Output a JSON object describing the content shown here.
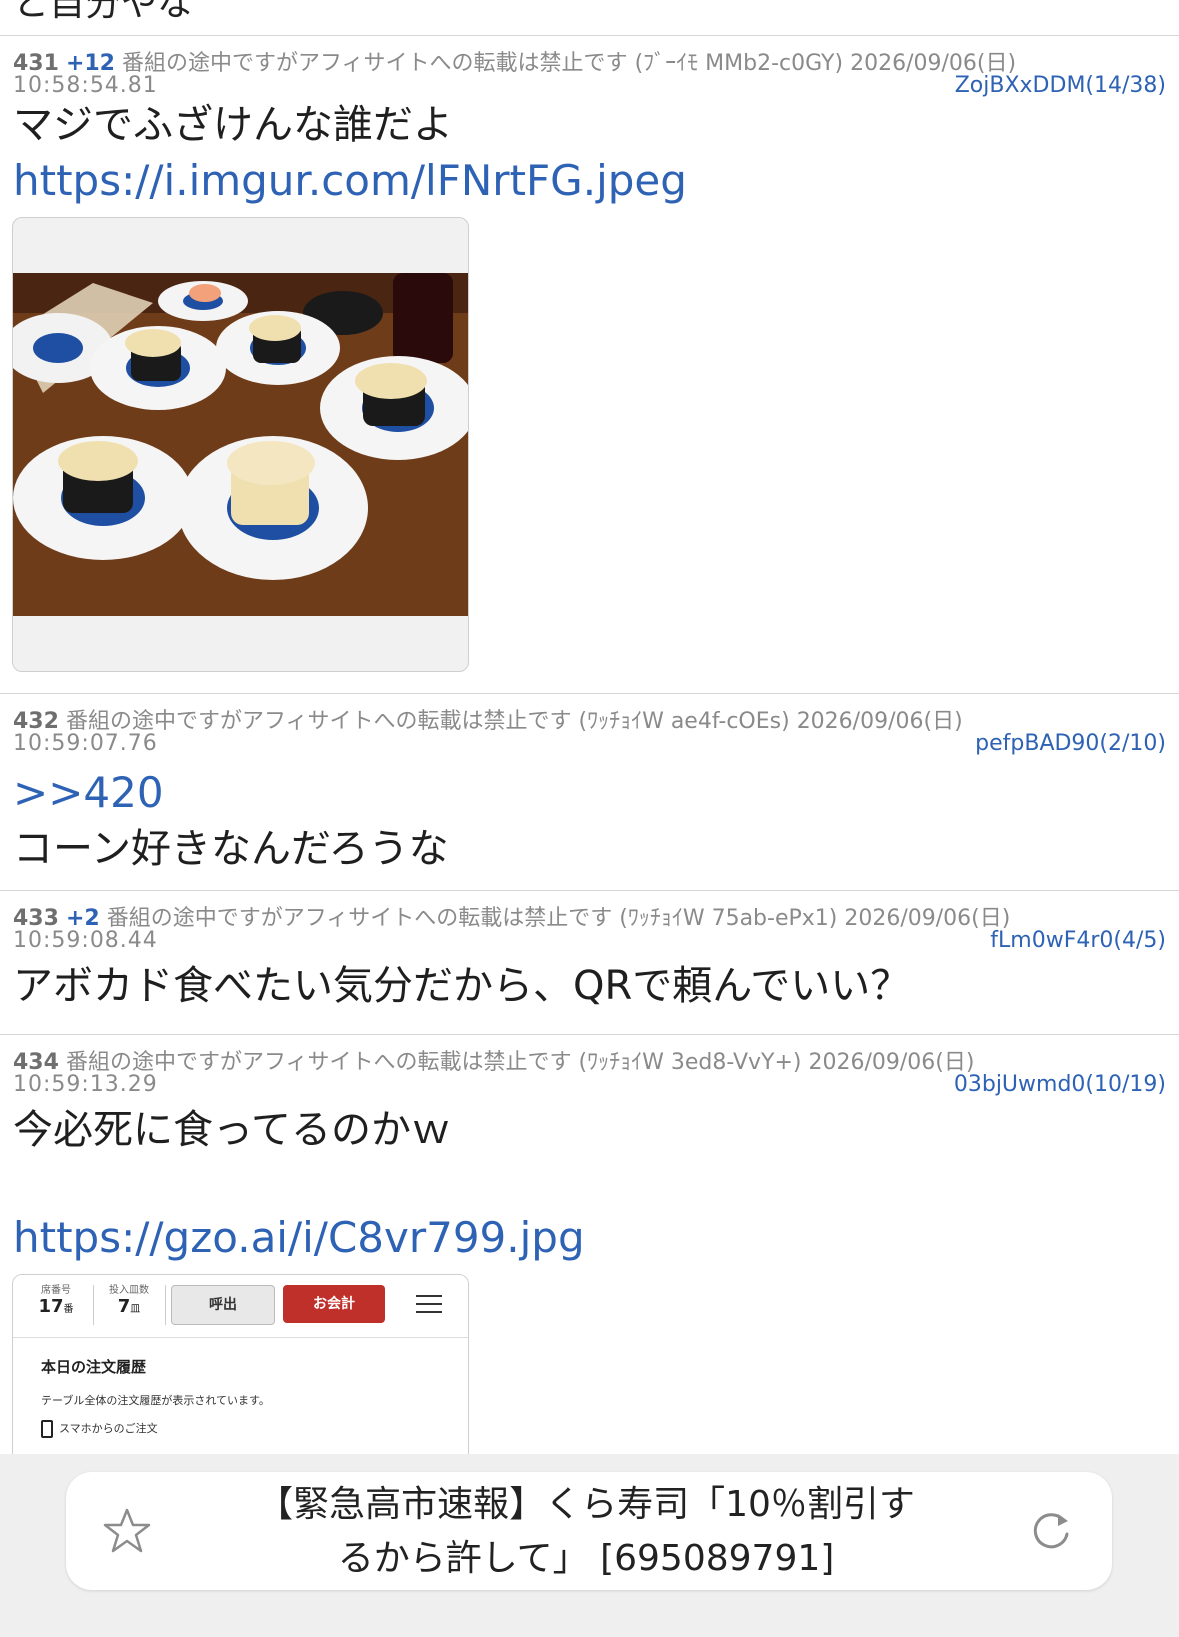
{
  "top_partial_text": "と自分やな",
  "posts": [
    {
      "num": "431",
      "plus": "+12",
      "name": "番組の途中ですがアフィサイトへの転載は禁止です",
      "tag": "(ﾌﾞｰｲﾓ MMb2-c0GY)",
      "date": "2026/09/06(日)",
      "time": "10:58:54.81",
      "uid": "ZojBXxDDM(14/38)",
      "text": "マジでふざけんな誰だよ",
      "link": "https://i.imgur.com/lFNrtFG.jpeg"
    },
    {
      "num": "432",
      "name": "番組の途中ですがアフィサイトへの転載は禁止です",
      "tag": "(ﾜｯﾁｮｲW ae4f-cOEs)",
      "date": "2026/09/06(日)",
      "time": "10:59:07.76",
      "uid": "pefpBAD90(2/10)",
      "anchor": ">>420",
      "text": "コーン好きなんだろうな"
    },
    {
      "num": "433",
      "plus": "+2",
      "name": "番組の途中ですがアフィサイトへの転載は禁止です",
      "tag": "(ﾜｯﾁｮｲW 75ab-ePx1)",
      "date": "2026/09/06(日)",
      "time": "10:59:08.44",
      "uid": "fLm0wF4r0(4/5)",
      "text": "アボカド食べたい気分だから、QRで頼んでいい？"
    },
    {
      "num": "434",
      "name": "番組の途中ですがアフィサイトへの転載は禁止です",
      "tag": "(ﾜｯﾁｮｲW 3ed8-VvY+)",
      "date": "2026/09/06(日)",
      "time": "10:59:13.29",
      "uid": "03bjUwmd0(10/19)",
      "text": "今必死に食ってるのかｗ",
      "link": "https://gzo.ai/i/C8vr799.jpg"
    }
  ],
  "app_screenshot": {
    "seat_label": "席番号",
    "seat_value": "17",
    "seat_unit": "番",
    "plates_label": "投入皿数",
    "plates_value": "7",
    "plates_unit": "皿",
    "call_button": "呼出",
    "checkout_button": "お会計",
    "history_title": "本日の注文履歴",
    "history_desc": "テーブル全体の注文履歴が表示されています。",
    "smartphone_order": "スマホからのご注文"
  },
  "thread_title": "【緊急高市速報】くら寿司「10％割引するから許して」 [695089791]",
  "colors": {
    "link": "#2e62b4",
    "meta": "#8a8a8a",
    "checkout": "#c0302b"
  }
}
